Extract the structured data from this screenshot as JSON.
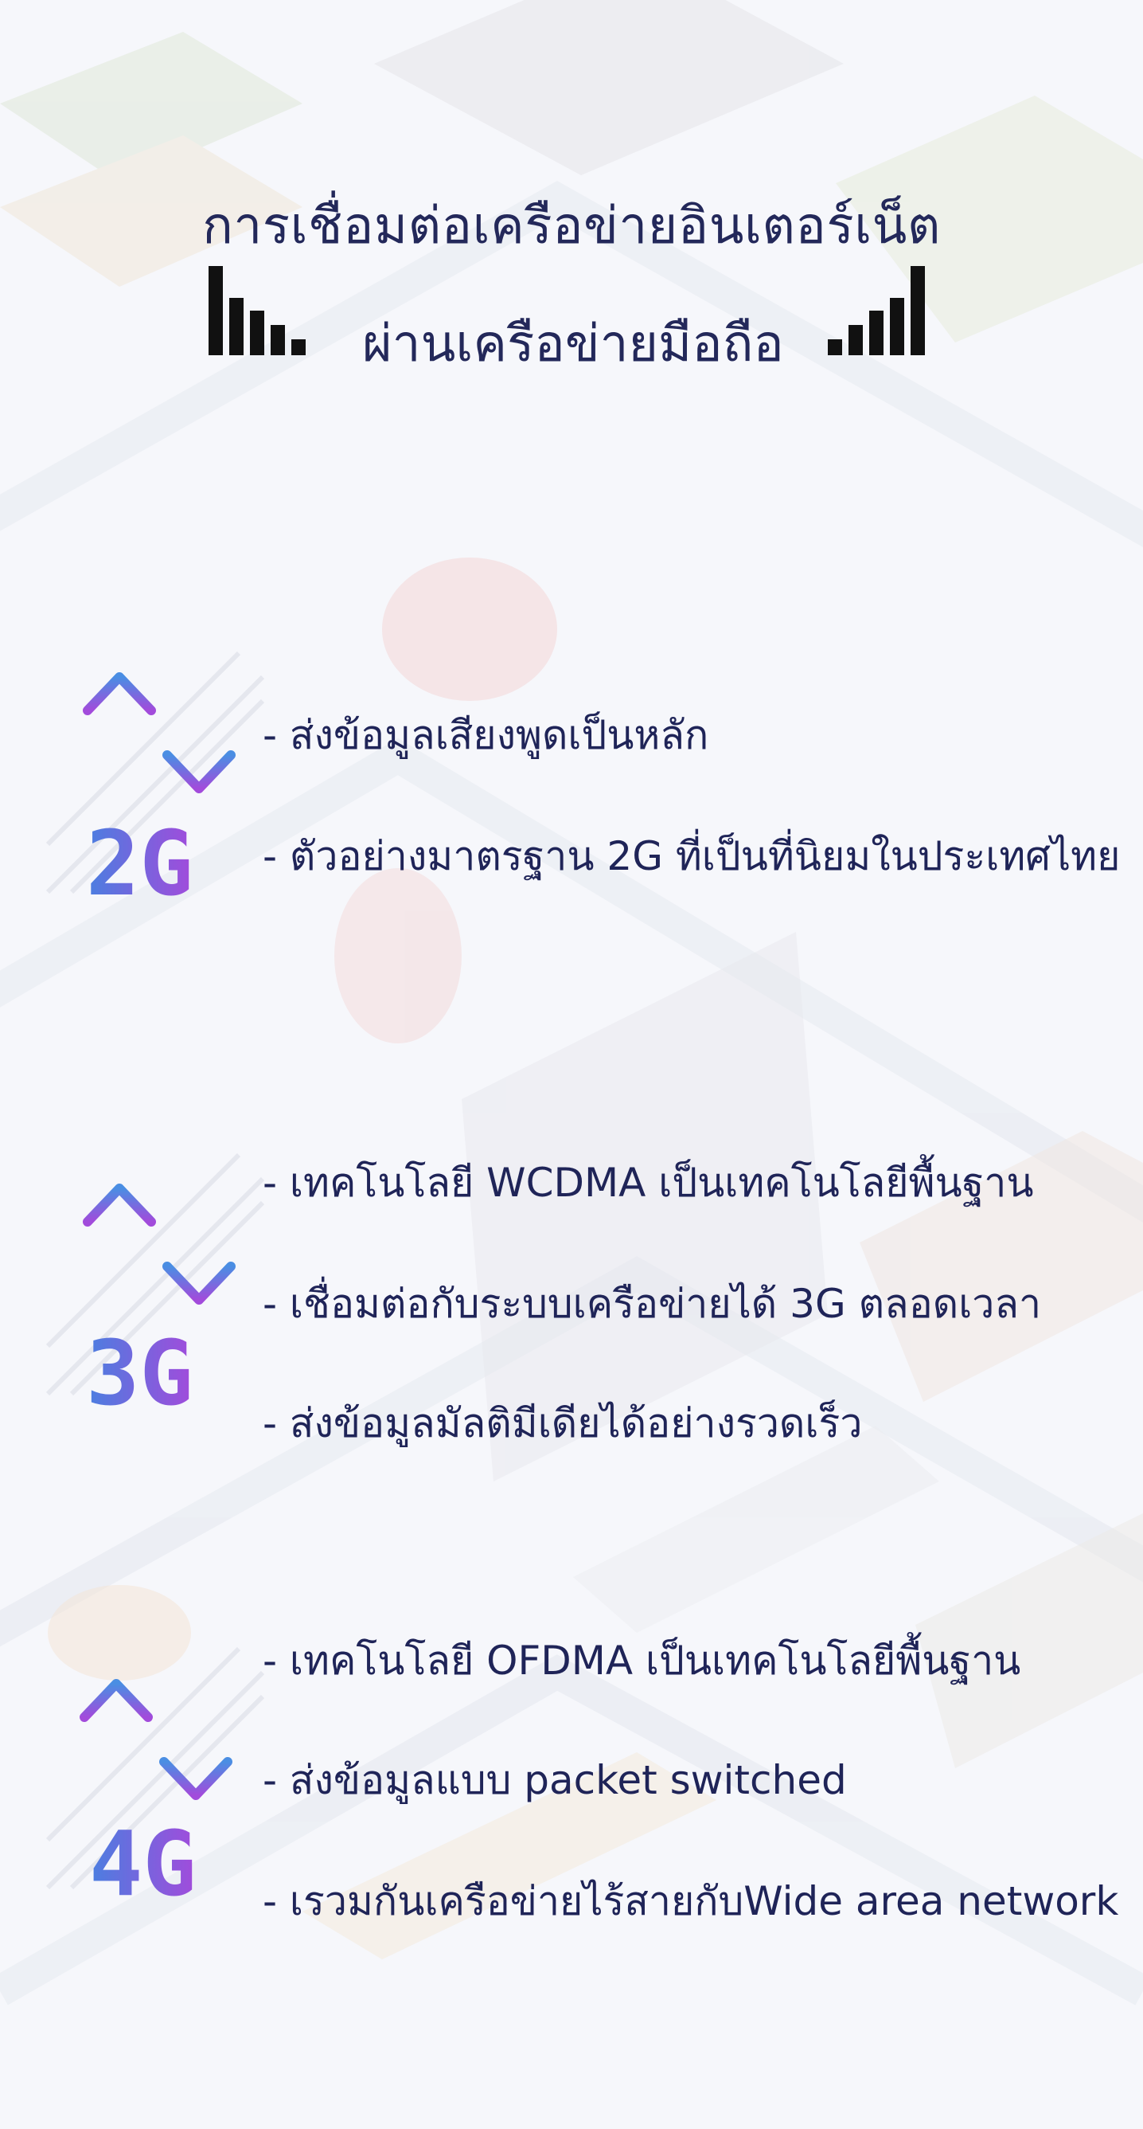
{
  "title": {
    "line1": "การเชื่อมต่อเครือข่ายอินเตอร์เน็ต",
    "line2": "ผ่านเครือข่ายมือถือ"
  },
  "sections": [
    {
      "label": "2G",
      "bullets": [
        "- ส่งข้อมูลเสียงพูดเป็นหลัก",
        "- ตัวอย่างมาตรฐาน 2G ที่เป็นที่นิยมในประเทศไทย"
      ]
    },
    {
      "label": "3G",
      "bullets": [
        "- เทคโนโลยี WCDMA เป็นเทคโนโลยีพื้นฐาน",
        "- เชื่อมต่อกับระบบเครือข่ายได้ 3G ตลอดเวลา",
        "- ส่งข้อมูลมัลติมีเดียได้อย่างรวดเร็ว"
      ]
    },
    {
      "label": "4G",
      "bullets": [
        "- เทคโนโลยี OFDMA เป็นเทคโนโลยีพื้นฐาน",
        "- ส่งข้อมูลแบบ packet switched",
        "- เรวมกันเครือข่ายไร้สายกับWide area network"
      ]
    }
  ],
  "colors": {
    "title": "#23285a",
    "text": "#1f2458",
    "gradient_start": "#4a7fe0",
    "gradient_end": "#a24bdb"
  },
  "icons": [
    "signal-decreasing-icon",
    "signal-increasing-icon",
    "up-down-arrows-icon"
  ]
}
